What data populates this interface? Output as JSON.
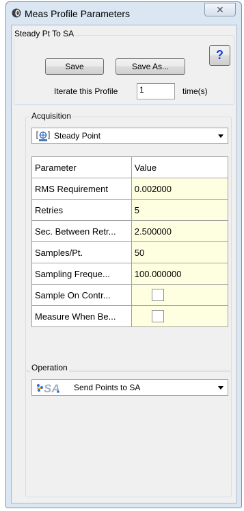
{
  "window": {
    "title": "Meas Profile Parameters",
    "close_glyph": "✕"
  },
  "profile_group": {
    "label": "Steady Pt To SA",
    "save_label": "Save",
    "save_as_label": "Save As...",
    "help_label": "?",
    "iterate_label": "Iterate this Profile",
    "iterate_value": "1",
    "iterate_unit": "time(s)"
  },
  "acquisition": {
    "label": "Acquisition",
    "selected": "Steady Point",
    "icon": "steady-point-icon"
  },
  "parameters": {
    "header": {
      "parameter": "Parameter",
      "value": "Value"
    },
    "rows": [
      {
        "name": "RMS Requirement",
        "value": "0.002000"
      },
      {
        "name": "Retries",
        "value": "5"
      },
      {
        "name": "Sec. Between Retr...",
        "value": "2.500000"
      },
      {
        "name": "Samples/Pt.",
        "value": "50"
      },
      {
        "name": "Sampling Freque...",
        "value": "100.000000"
      },
      {
        "name": "Sample On Contr...",
        "checked": false
      },
      {
        "name": "Measure When Be...",
        "checked": false
      }
    ]
  },
  "operation": {
    "label": "Operation",
    "selected": "Send Points to SA",
    "icon": "sa-send-points-icon"
  },
  "colors": {
    "value_cell_bg": "#fefee1",
    "window_frame": "#dbe6f3",
    "dialog_bg": "#f0f0f0",
    "help_accent": "#1a3fd8"
  }
}
